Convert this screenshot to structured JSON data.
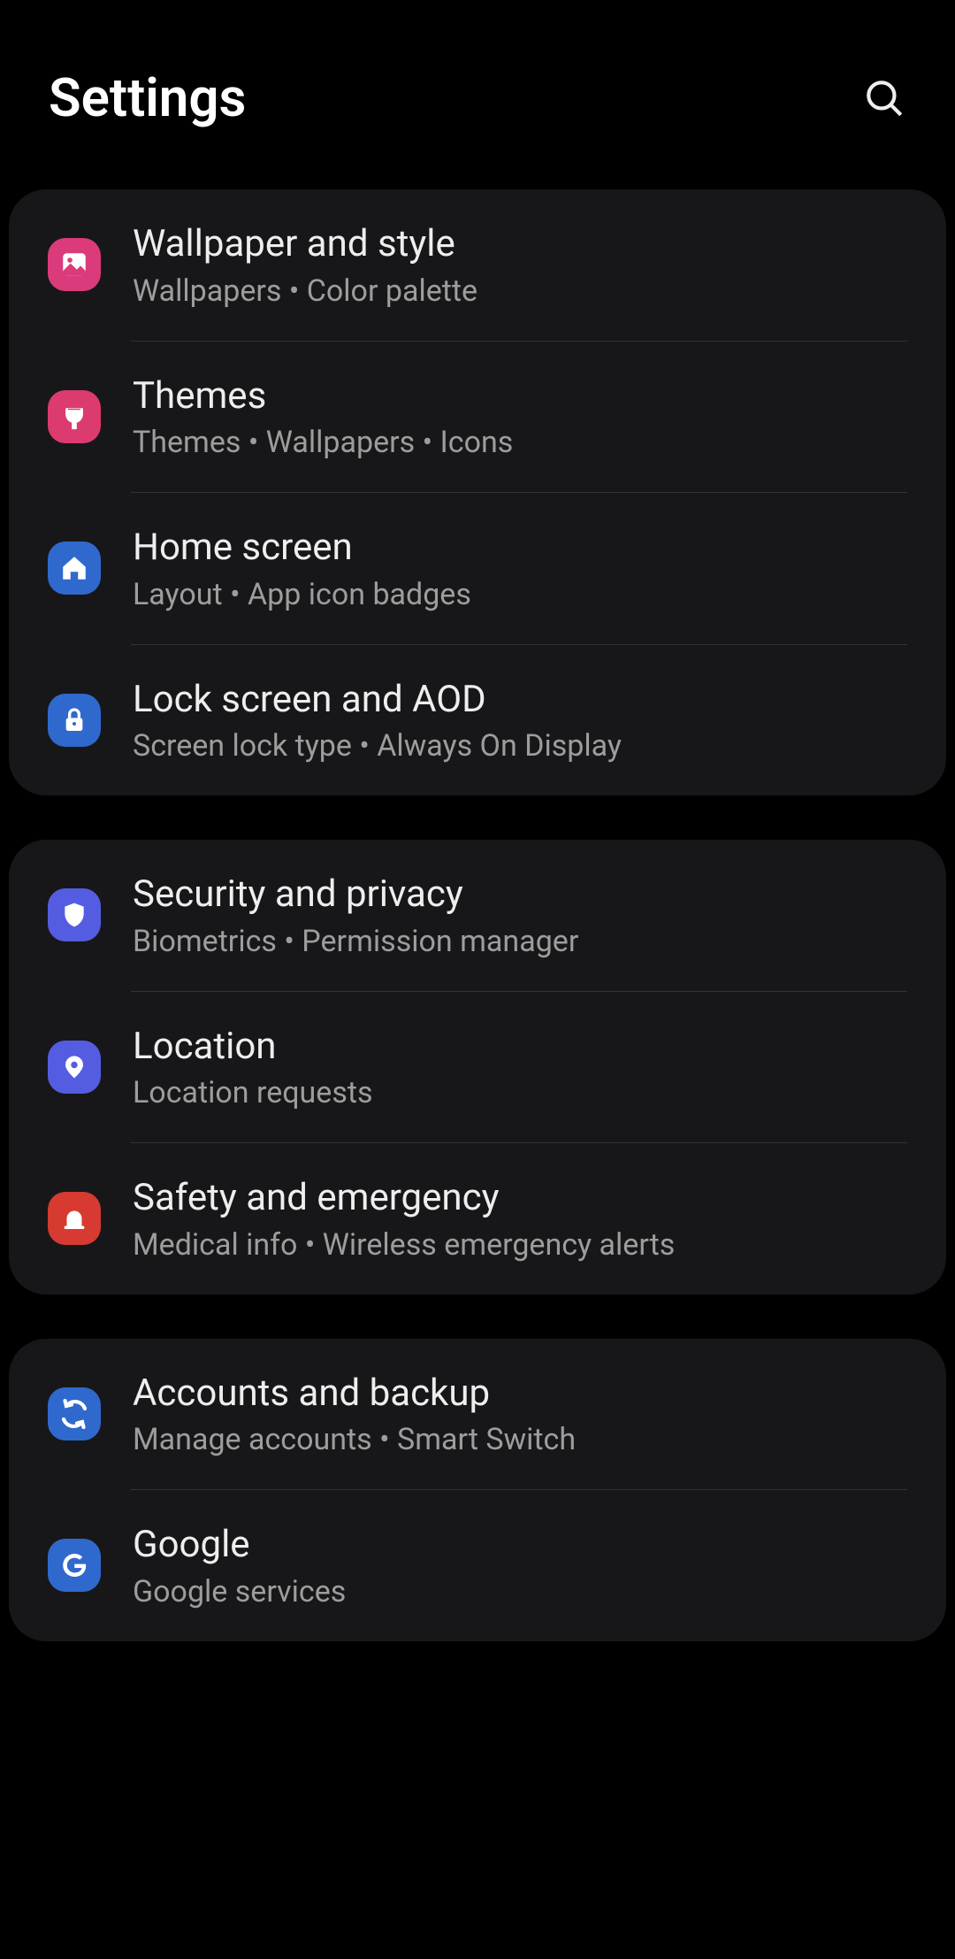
{
  "header": {
    "title": "Settings"
  },
  "groups": [
    {
      "items": [
        {
          "id": "wallpaper-and-style",
          "title": "Wallpaper and style",
          "sub": "Wallpapers  •  Color palette",
          "icon": "picture-icon",
          "color": "#db3b7b"
        },
        {
          "id": "themes",
          "title": "Themes",
          "sub": "Themes  •  Wallpapers  •  Icons",
          "icon": "brush-icon",
          "color": "#db3b6e"
        },
        {
          "id": "home-screen",
          "title": "Home screen",
          "sub": "Layout  •  App icon badges",
          "icon": "home-icon",
          "color": "#3069cd"
        },
        {
          "id": "lock-screen-aod",
          "title": "Lock screen and AOD",
          "sub": "Screen lock type  •  Always On Display",
          "icon": "lock-icon",
          "color": "#3069cd"
        }
      ]
    },
    {
      "items": [
        {
          "id": "security-privacy",
          "title": "Security and privacy",
          "sub": "Biometrics  •  Permission manager",
          "icon": "shield-icon",
          "color": "#545de1"
        },
        {
          "id": "location",
          "title": "Location",
          "sub": "Location requests",
          "icon": "location-pin-icon",
          "color": "#545de1"
        },
        {
          "id": "safety-emergency",
          "title": "Safety and emergency",
          "sub": "Medical info  •  Wireless emergency alerts",
          "icon": "emergency-icon",
          "color": "#d63a30"
        }
      ]
    },
    {
      "items": [
        {
          "id": "accounts-backup",
          "title": "Accounts and backup",
          "sub": "Manage accounts  •  Smart Switch",
          "icon": "sync-icon",
          "color": "#3069cd"
        },
        {
          "id": "google",
          "title": "Google",
          "sub": "Google services",
          "icon": "google-icon",
          "color": "#3069cd"
        }
      ]
    }
  ]
}
